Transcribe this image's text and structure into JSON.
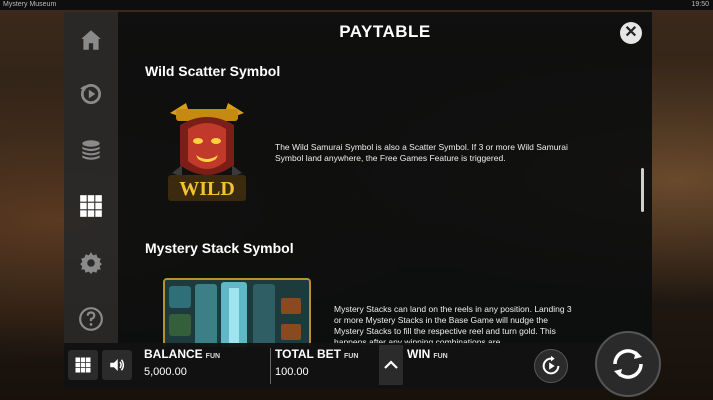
{
  "window": {
    "title": "Mystery Museum",
    "clock": "19:50"
  },
  "panel": {
    "title": "PAYTABLE",
    "sections": [
      {
        "heading": "Wild Scatter Symbol",
        "symbol_text": "WILD",
        "description": "The Wild Samurai Symbol is also a Scatter Symbol. If 3 or more Wild Samurai Symbol land anywhere, the Free Games Feature is triggered."
      },
      {
        "heading": "Mystery Stack Symbol",
        "description": "Mystery Stacks can land on the reels in any position. Landing 3 or more Mystery Stacks in the Base Game will nudge the Mystery Stacks to fill the respective reel and turn gold. This happens after any winning combinations are"
      }
    ]
  },
  "side_nav": [
    "home-icon",
    "autoplay-history-icon",
    "coins-icon",
    "paytable-grid-icon",
    "settings-gear-icon",
    "help-icon"
  ],
  "bottom_bar": {
    "balance_label": "BALANCE",
    "balance_unit": "FUN",
    "balance_value": "5,000.00",
    "bet_label": "TOTAL BET",
    "bet_unit": "FUN",
    "bet_value": "100.00",
    "win_label": "WIN",
    "win_unit": "FUN"
  },
  "colors": {
    "accent_gold": "#d4a017",
    "panel_bg": "#0c0e0e",
    "text": "#ffffff"
  }
}
